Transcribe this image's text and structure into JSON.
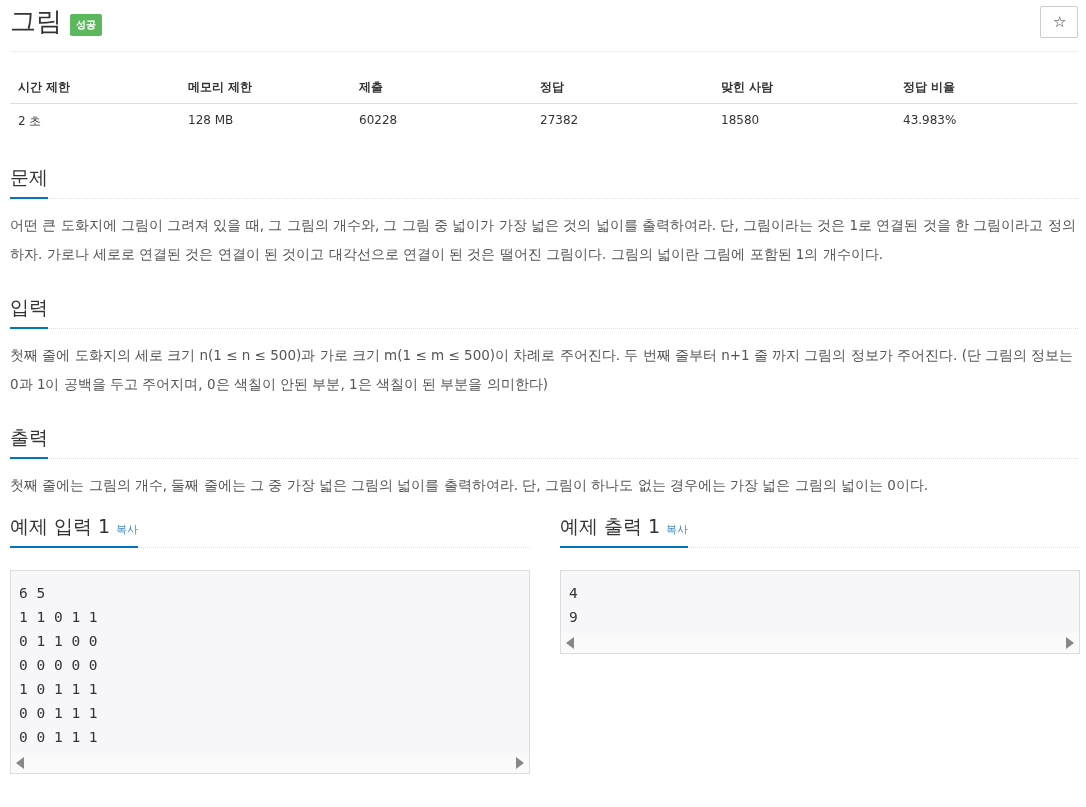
{
  "problem": {
    "title": "그림",
    "badge": "성공",
    "star": "☆"
  },
  "stats": {
    "columns": [
      "시간 제한",
      "메모리 제한",
      "제출",
      "정답",
      "맞힌 사람",
      "정답 비율"
    ],
    "row": [
      "2 초",
      "128 MB",
      "60228",
      "27382",
      "18580",
      "43.983%"
    ]
  },
  "sections": [
    {
      "heading": "문제",
      "text": "어떤 큰 도화지에 그림이 그려져 있을 때, 그 그림의 개수와, 그 그림 중 넓이가 가장 넓은 것의 넓이를 출력하여라. 단, 그림이라는 것은 1로 연결된 것을 한 그림이라고 정의하자. 가로나 세로로 연결된 것은 연결이 된 것이고 대각선으로 연결이 된 것은 떨어진 그림이다. 그림의 넓이란 그림에 포함된 1의 개수이다."
    },
    {
      "heading": "입력",
      "text": "첫째 줄에 도화지의 세로 크기 n(1 ≤ n ≤ 500)과 가로 크기 m(1 ≤ m ≤ 500)이 차례로 주어진다. 두 번째 줄부터 n+1 줄 까지 그림의 정보가 주어진다. (단 그림의 정보는 0과 1이 공백을 두고 주어지며, 0은 색칠이 안된 부분, 1은 색칠이 된 부분을 의미한다)"
    },
    {
      "heading": "출력",
      "text": "첫째 줄에는 그림의 개수, 둘째 줄에는 그 중 가장 넓은 그림의 넓이를 출력하여라. 단, 그림이 하나도 없는 경우에는 가장 넓은 그림의 넓이는 0이다."
    }
  ],
  "samples": [
    {
      "heading": "예제 입력 1",
      "copy": "복사",
      "lines": [
        "6 5",
        "1 1 0 1 1",
        "0 1 1 0 0",
        "0 0 0 0 0",
        "1 0 1 1 1",
        "0 0 1 1 1",
        "0 0 1 1 1"
      ]
    },
    {
      "heading": "예제 출력 1",
      "copy": "복사",
      "lines": [
        "4",
        "9"
      ]
    }
  ]
}
